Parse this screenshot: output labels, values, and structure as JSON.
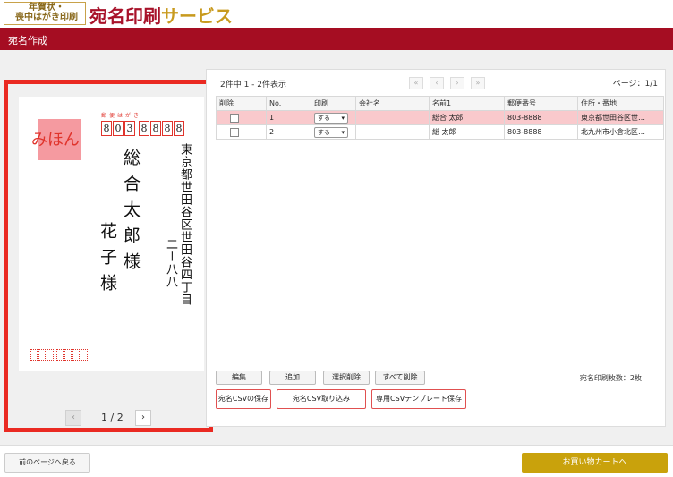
{
  "header": {
    "logo_small_line1": "年賀状・",
    "logo_small_line2": "喪中はがき印刷",
    "service_red": "宛名印刷",
    "service_gold": "サービス",
    "page_title": "宛名作成"
  },
  "preview": {
    "postcard_label": "郵便はがき",
    "zip_digits": [
      "8",
      "0",
      "3",
      "8",
      "8",
      "8",
      "8"
    ],
    "mihon": "みほん",
    "address_line1": "東京都世田谷区世田谷四丁目",
    "address_line2": "二ー八八",
    "recipient_main": "総合太郎様",
    "recipient_sub": "花子様",
    "page_indicator": "1 / 2",
    "prev_icon": "‹",
    "next_icon": "›"
  },
  "list": {
    "count_text": "2件中 1 - 2件表示",
    "page_info": "ページ：1/1",
    "nav_first": "«",
    "nav_prev": "‹",
    "nav_next": "›",
    "nav_last": "»",
    "columns": [
      "削除",
      "No.",
      "印刷",
      "会社名",
      "名前1",
      "郵便番号",
      "住所・番地"
    ],
    "rows": [
      {
        "no": "1",
        "print": "する",
        "company": "",
        "name": "総合 太郎",
        "zip": "803-8888",
        "address": "東京都世田谷区世…",
        "selected": true
      },
      {
        "no": "2",
        "print": "する",
        "company": "",
        "name": "総 太郎",
        "zip": "803-8888",
        "address": "北九州市小倉北区…",
        "selected": false
      }
    ],
    "btn_edit": "編集",
    "btn_add": "追加",
    "btn_delete_selected": "選択削除",
    "btn_delete_all": "すべて削除",
    "btn_save_csv": "宛名CSVの保存",
    "btn_import_csv": "宛名CSV取り込み",
    "btn_save_template": "専用CSVテンプレート保存",
    "print_count": "宛名印刷枚数：2枚"
  },
  "footer": {
    "back_label": "前のページへ戻る",
    "cart_label": "お買い物カートへ"
  },
  "colors": {
    "brand_red": "#a50d22",
    "accent_gold": "#c9a20c",
    "highlight_pink": "#f9c9cc"
  }
}
